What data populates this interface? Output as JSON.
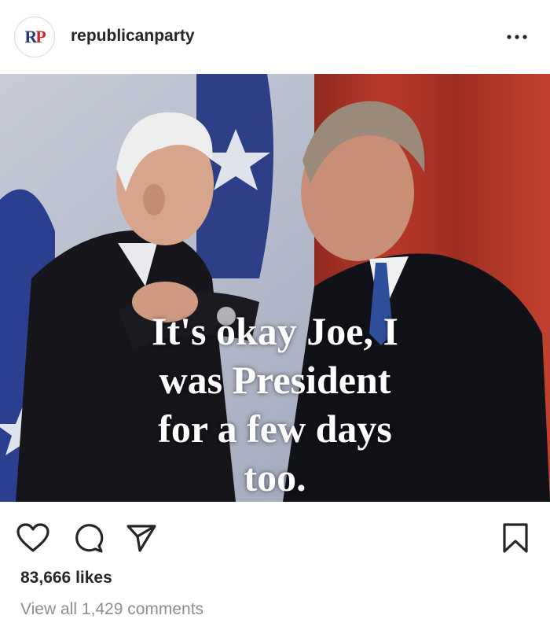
{
  "post": {
    "username": "republicanparty",
    "avatar_text_r": "R",
    "avatar_text_p": "P",
    "image_caption_lines": [
      "It's okay Joe, I",
      "was President",
      "for a few days",
      "too."
    ],
    "likes": "83,666 likes",
    "view_comments": "View all 1,429 comments"
  },
  "icons": {
    "more": "more-options-icon",
    "like": "heart-icon",
    "comment": "comment-icon",
    "share": "send-icon",
    "save": "bookmark-icon"
  },
  "colors": {
    "brand_red": "#d3202a",
    "brand_blue": "#1f3a8a",
    "text": "#262626",
    "muted": "#8e8e8e"
  }
}
